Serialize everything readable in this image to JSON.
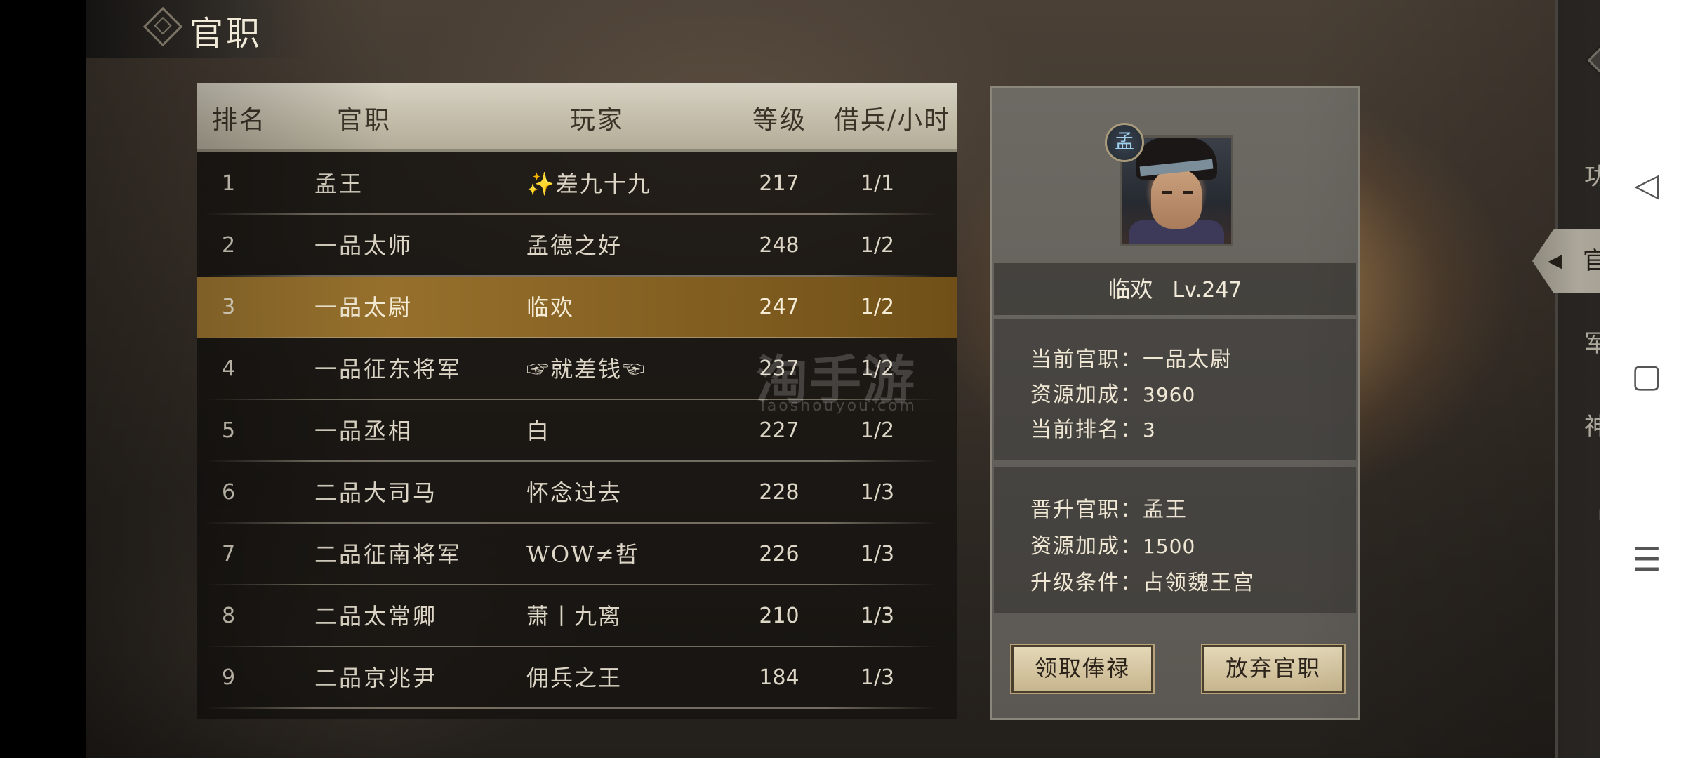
{
  "page": {
    "title": "官职"
  },
  "table": {
    "headers": {
      "rank": "排名",
      "title": "官职",
      "player": "玩家",
      "level": "等级",
      "troops": "借兵/小时"
    },
    "rows": [
      {
        "rank": "1",
        "title": "孟王",
        "player": "✨差九十九",
        "level": "217",
        "troops": "1/1"
      },
      {
        "rank": "2",
        "title": "一品太师",
        "player": "孟德之好",
        "level": "248",
        "troops": "1/2"
      },
      {
        "rank": "3",
        "title": "一品太尉",
        "player": "临欢",
        "level": "247",
        "troops": "1/2"
      },
      {
        "rank": "4",
        "title": "一品征东将军",
        "player": "☞就差钱☜",
        "level": "237",
        "troops": "1/2"
      },
      {
        "rank": "5",
        "title": "一品丞相",
        "player": "白",
        "level": "227",
        "troops": "1/2"
      },
      {
        "rank": "6",
        "title": "二品大司马",
        "player": "怀念过去",
        "level": "228",
        "troops": "1/3"
      },
      {
        "rank": "7",
        "title": "二品征南将军",
        "player": "WOW≠哲",
        "level": "226",
        "troops": "1/3"
      },
      {
        "rank": "8",
        "title": "二品太常卿",
        "player": "萧丨九离",
        "level": "210",
        "troops": "1/3"
      },
      {
        "rank": "9",
        "title": "二品京兆尹",
        "player": "佣兵之王",
        "level": "184",
        "troops": "1/3"
      }
    ],
    "selected_rank": "3"
  },
  "watermark": {
    "main": "淘手游",
    "sub": "Taoshouyou.com"
  },
  "profile": {
    "badge": "孟",
    "name": "临欢",
    "level": "Lv.247",
    "current": {
      "title_label": "当前官职：",
      "title_value": "一品太尉",
      "bonus_label": "资源加成：",
      "bonus_value": "3960",
      "rank_label": "当前排名：",
      "rank_value": "3"
    },
    "promotion": {
      "title_label": "晋升官职：",
      "title_value": "孟王",
      "bonus_label": "资源加成：",
      "bonus_value": "1500",
      "cond_label": "升级条件：",
      "cond_value": "占领魏王宫"
    },
    "buttons": {
      "collect": "领取俸禄",
      "abandon": "放弃官职"
    }
  },
  "nav": {
    "close_icon": "close-icon",
    "items": [
      "功勋榜",
      "官职",
      "军功簿",
      "神兵阁",
      "战舰"
    ],
    "active_index": 1
  },
  "system_nav": {
    "back": "◁",
    "home": "▢",
    "menu": "☰"
  }
}
